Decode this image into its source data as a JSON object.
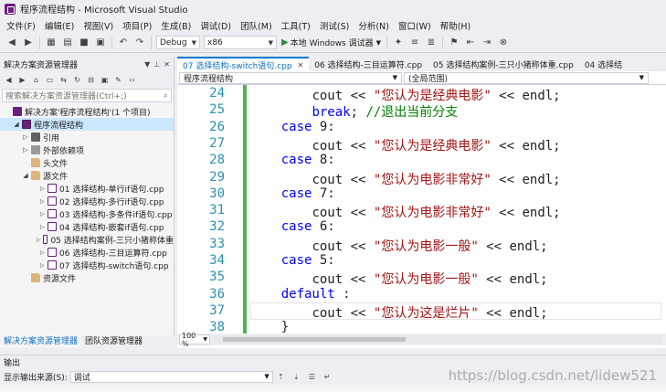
{
  "window": {
    "title": "程序流程结构 - Microsoft Visual Studio"
  },
  "menu": [
    "文件(F)",
    "编辑(E)",
    "视图(V)",
    "项目(P)",
    "生成(B)",
    "调试(D)",
    "团队(M)",
    "工具(T)",
    "测试(S)",
    "分析(N)",
    "窗口(W)",
    "帮助(H)"
  ],
  "toolbar": {
    "config": "Debug",
    "platform": "x86",
    "run_label": "本地 Windows 调试器"
  },
  "solution_explorer": {
    "title": "解决方案资源管理器",
    "search_placeholder": "搜索解决方案资源管理器(Ctrl+;)",
    "items": [
      {
        "label": "解决方案'程序流程结构'(1 个项目)",
        "indent": 0,
        "icon": "solution-icon"
      },
      {
        "label": "程序流程结构",
        "indent": 1,
        "icon": "project-icon",
        "selected": true
      },
      {
        "label": "引用",
        "indent": 2,
        "icon": "references-icon"
      },
      {
        "label": "外部依赖项",
        "indent": 2,
        "icon": "dependencies-icon"
      },
      {
        "label": "头文件",
        "indent": 2,
        "icon": "folder-icon"
      },
      {
        "label": "源文件",
        "indent": 2,
        "icon": "folder-icon"
      },
      {
        "label": "01 选择结构-单行if语句.cpp",
        "indent": 3,
        "icon": "cpp-file-icon"
      },
      {
        "label": "02 选择结构-多行if语句.cpp",
        "indent": 3,
        "icon": "cpp-file-icon"
      },
      {
        "label": "03 选择结构-多条件if语句.cpp",
        "indent": 3,
        "icon": "cpp-file-icon"
      },
      {
        "label": "04 选择结构-嵌套if语句.cpp",
        "indent": 3,
        "icon": "cpp-file-icon"
      },
      {
        "label": "05 选择结构案例-三只小猪称体重",
        "indent": 3,
        "icon": "cpp-file-icon"
      },
      {
        "label": "06 选择结构-三目运算符.cpp",
        "indent": 3,
        "icon": "cpp-file-icon"
      },
      {
        "label": "07 选择结构-switch语句.cpp",
        "indent": 3,
        "icon": "cpp-file-icon"
      },
      {
        "label": "资源文件",
        "indent": 2,
        "icon": "folder-icon"
      }
    ],
    "bottom_tabs": [
      "解决方案资源管理器",
      "团队资源管理器"
    ]
  },
  "editor": {
    "tabs": [
      {
        "label": "07 选择结构-switch语句.cpp",
        "active": true
      },
      {
        "label": "06 选择结构-三目运算符.cpp",
        "active": false
      },
      {
        "label": "05 选择结构案例-三只小猪称体重.cpp",
        "active": false
      },
      {
        "label": "04 选择结",
        "active": false
      }
    ],
    "nav_project": "程序流程结构",
    "nav_scope": "(全局范围)",
    "zoom": "100 %",
    "lines": [
      {
        "num": "24",
        "indent": "        ",
        "tokens": [
          [
            "cout ",
            "op"
          ],
          [
            "<< ",
            "op"
          ],
          [
            "\"您认为是经典电影\"",
            "str"
          ],
          [
            " << endl;",
            "op"
          ]
        ]
      },
      {
        "num": "25",
        "indent": "        ",
        "tokens": [
          [
            "break",
            "kw"
          ],
          [
            "; ",
            "op"
          ],
          [
            "//退出当前分支",
            "cm"
          ]
        ]
      },
      {
        "num": "26",
        "indent": "    ",
        "tokens": [
          [
            "case",
            "kw"
          ],
          [
            " 9:",
            "op"
          ]
        ]
      },
      {
        "num": "27",
        "indent": "        ",
        "tokens": [
          [
            "cout ",
            "op"
          ],
          [
            "<< ",
            "op"
          ],
          [
            "\"您认为是经典电影\"",
            "str"
          ],
          [
            " << endl;",
            "op"
          ]
        ]
      },
      {
        "num": "28",
        "indent": "    ",
        "tokens": [
          [
            "case",
            "kw"
          ],
          [
            " 8:",
            "op"
          ]
        ]
      },
      {
        "num": "29",
        "indent": "        ",
        "tokens": [
          [
            "cout ",
            "op"
          ],
          [
            "<< ",
            "op"
          ],
          [
            "\"您认为电影非常好\"",
            "str"
          ],
          [
            " << endl;",
            "op"
          ]
        ]
      },
      {
        "num": "30",
        "indent": "    ",
        "tokens": [
          [
            "case",
            "kw"
          ],
          [
            " 7:",
            "op"
          ]
        ]
      },
      {
        "num": "31",
        "indent": "        ",
        "tokens": [
          [
            "cout ",
            "op"
          ],
          [
            "<< ",
            "op"
          ],
          [
            "\"您认为电影非常好\"",
            "str"
          ],
          [
            " << endl;",
            "op"
          ]
        ]
      },
      {
        "num": "32",
        "indent": "    ",
        "tokens": [
          [
            "case",
            "kw"
          ],
          [
            " 6:",
            "op"
          ]
        ]
      },
      {
        "num": "33",
        "indent": "        ",
        "tokens": [
          [
            "cout ",
            "op"
          ],
          [
            "<< ",
            "op"
          ],
          [
            "\"您认为电影一般\"",
            "str"
          ],
          [
            " << endl;",
            "op"
          ]
        ]
      },
      {
        "num": "34",
        "indent": "    ",
        "tokens": [
          [
            "case",
            "kw"
          ],
          [
            " 5:",
            "op"
          ]
        ]
      },
      {
        "num": "35",
        "indent": "        ",
        "tokens": [
          [
            "cout ",
            "op"
          ],
          [
            "<< ",
            "op"
          ],
          [
            "\"您认为电影一般\"",
            "str"
          ],
          [
            " << endl;",
            "op"
          ]
        ]
      },
      {
        "num": "36",
        "indent": "    ",
        "tokens": [
          [
            "default",
            "kw"
          ],
          [
            " :",
            "op"
          ]
        ]
      },
      {
        "num": "37",
        "indent": "        ",
        "tokens": [
          [
            "cout ",
            "op"
          ],
          [
            "<< ",
            "op"
          ],
          [
            "\"您认为这是烂片\"",
            "str"
          ],
          [
            " << endl;",
            "op"
          ]
        ]
      },
      {
        "num": "38",
        "indent": "    ",
        "tokens": [
          [
            "}",
            "op"
          ]
        ]
      }
    ]
  },
  "output": {
    "title": "输出",
    "source_label": "显示输出来源(S):",
    "source_value": "调试"
  },
  "watermark": "https://blog.csdn.net/lidew521"
}
